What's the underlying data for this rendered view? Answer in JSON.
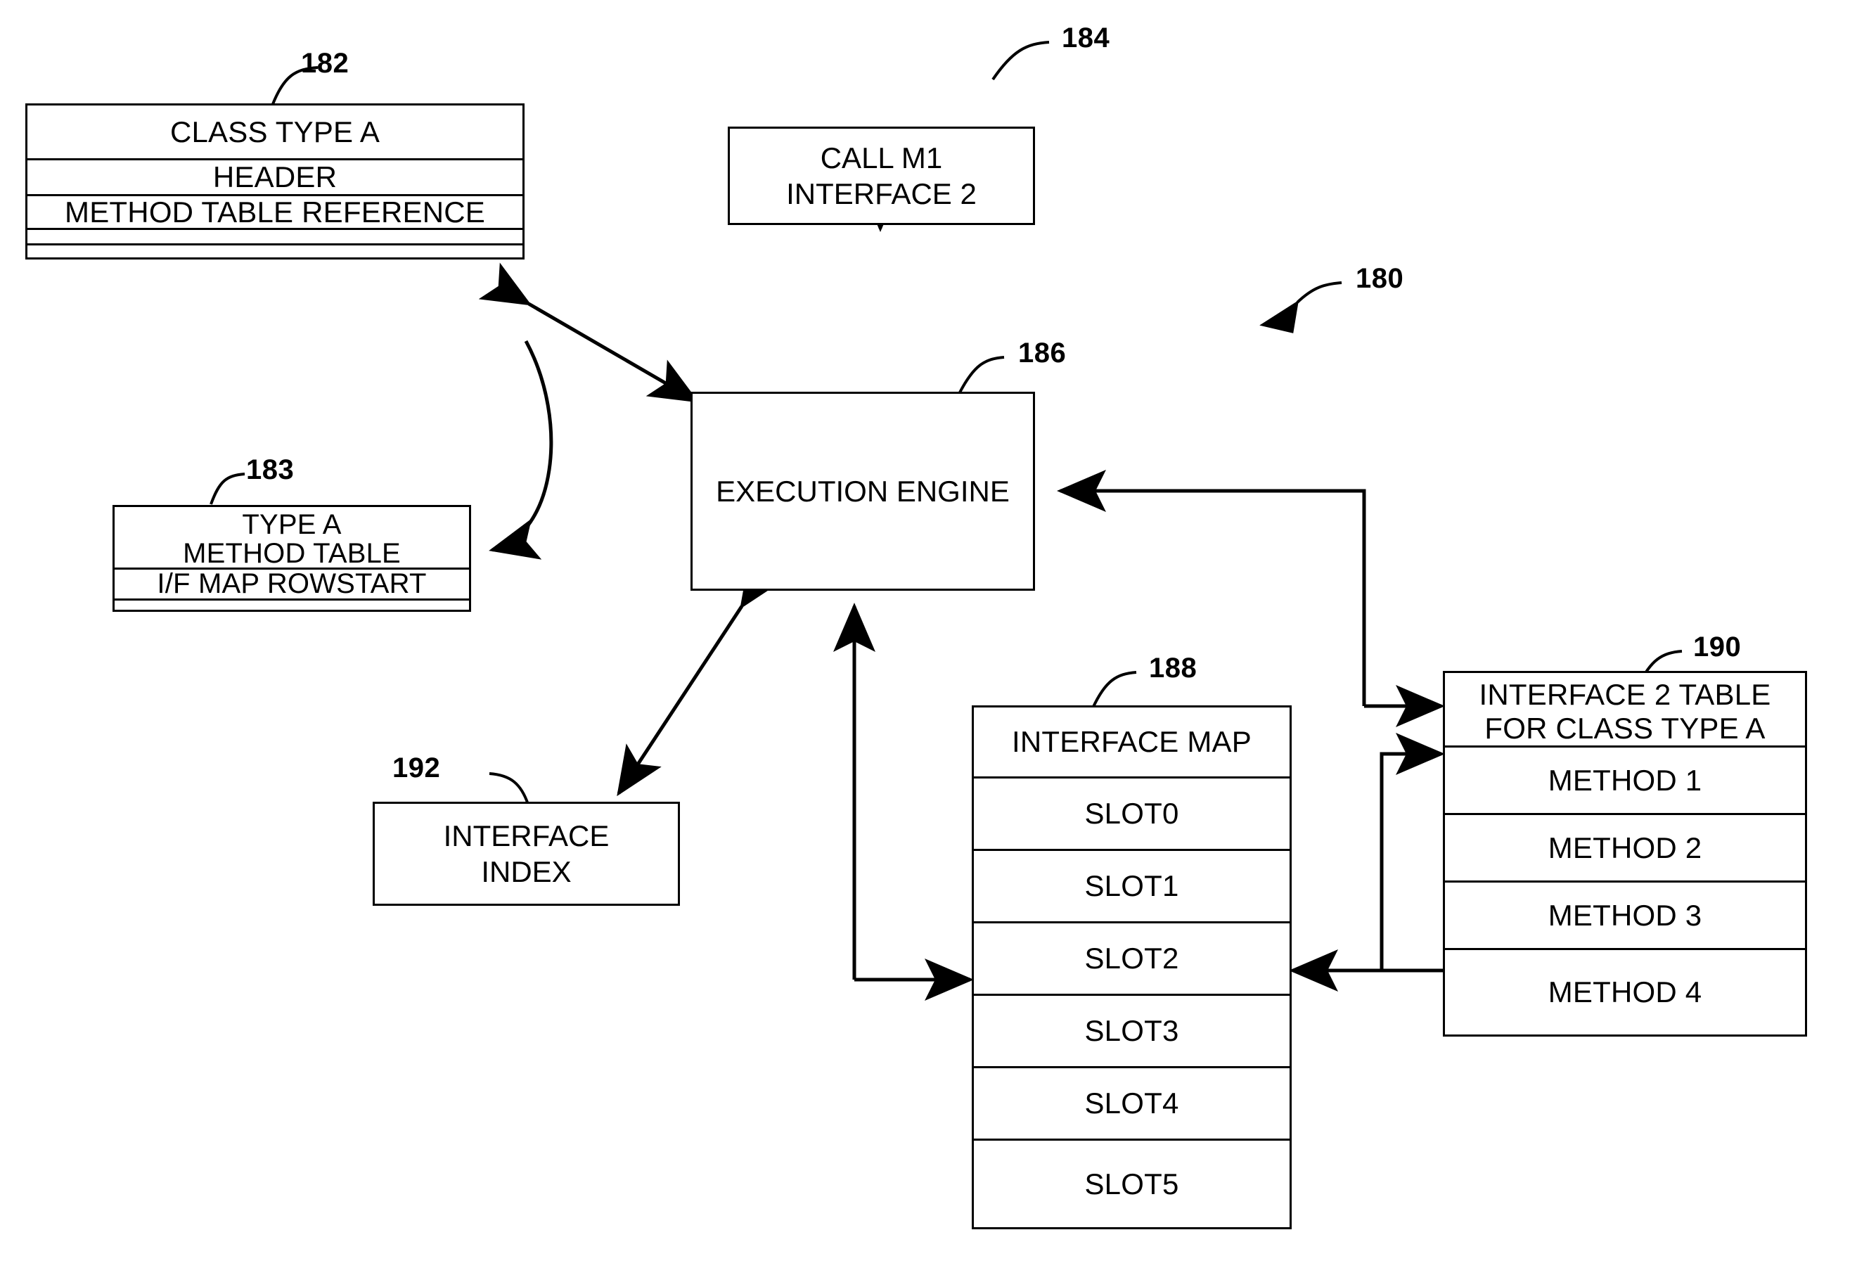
{
  "figure": {
    "reference_numerals": {
      "assembly": "180",
      "class_type_a": "182",
      "method_table": "183",
      "call_site": "184",
      "execution_engine": "186",
      "interface_map": "188",
      "interface_2_table": "190",
      "interface_index": "192"
    }
  },
  "class_type_a_box": {
    "title": "CLASS TYPE A",
    "rows": [
      "HEADER",
      "METHOD TABLE REFERENCE",
      "",
      ""
    ]
  },
  "method_table_box": {
    "title_line_1": "TYPE A",
    "title_line_2": "METHOD TABLE",
    "rows": [
      "I/F MAP ROWSTART",
      ""
    ]
  },
  "call_box": {
    "line_1": "CALL M1",
    "line_2": "INTERFACE 2"
  },
  "execution_engine_box": {
    "label": "EXECUTION ENGINE"
  },
  "interface_index_box": {
    "line_1": "INTERFACE",
    "line_2": "INDEX"
  },
  "interface_map_box": {
    "title": "INTERFACE MAP",
    "slots": [
      "SLOT0",
      "SLOT1",
      "SLOT2",
      "SLOT3",
      "SLOT4",
      "SLOT5"
    ]
  },
  "interface_2_table_box": {
    "title_line_1": "INTERFACE 2 TABLE",
    "title_line_2": "FOR CLASS TYPE A",
    "methods": [
      "METHOD 1",
      "METHOD 2",
      "METHOD 3",
      "METHOD 4"
    ]
  },
  "colors": {
    "stroke": "#000000",
    "background": "#ffffff"
  }
}
